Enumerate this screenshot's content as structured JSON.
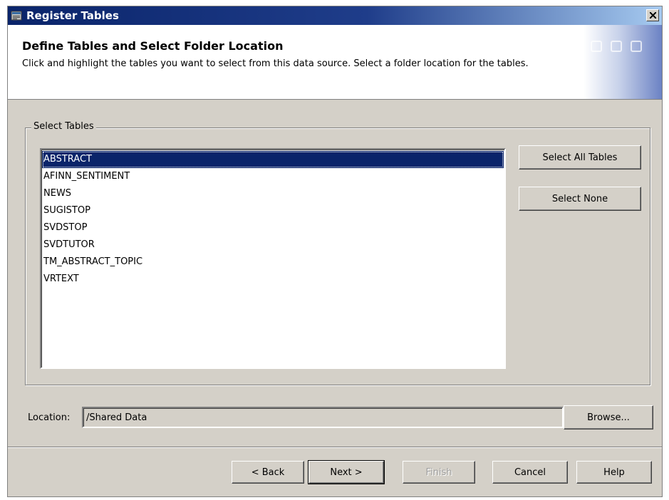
{
  "window": {
    "title": "Register Tables",
    "icon": "register-tables-icon",
    "close_icon": "close-icon"
  },
  "header": {
    "title": "Define Tables and Select Folder Location",
    "description": "Click and highlight the tables you want to select from this data source.  Select a folder location for the tables."
  },
  "select_tables": {
    "legend": "Select Tables",
    "tables": [
      {
        "name": "ABSTRACT",
        "selected": true
      },
      {
        "name": "AFINN_SENTIMENT",
        "selected": false
      },
      {
        "name": "NEWS",
        "selected": false
      },
      {
        "name": "SUGISTOP",
        "selected": false
      },
      {
        "name": "SVDSTOP",
        "selected": false
      },
      {
        "name": "SVDTUTOR",
        "selected": false
      },
      {
        "name": "TM_ABSTRACT_TOPIC",
        "selected": false
      },
      {
        "name": "VRTEXT",
        "selected": false
      }
    ],
    "select_all_label": "Select All Tables",
    "select_none_label": "Select None"
  },
  "location": {
    "label": "Location:",
    "value": "/Shared Data",
    "browse_label": "Browse..."
  },
  "footer": {
    "back_label": "< Back",
    "next_label": "Next >",
    "finish_label": "Finish",
    "cancel_label": "Cancel",
    "help_label": "Help"
  },
  "colors": {
    "title_bar": "#0a246a",
    "selection": "#0a246a",
    "dialog_face": "#d4d0c8"
  }
}
